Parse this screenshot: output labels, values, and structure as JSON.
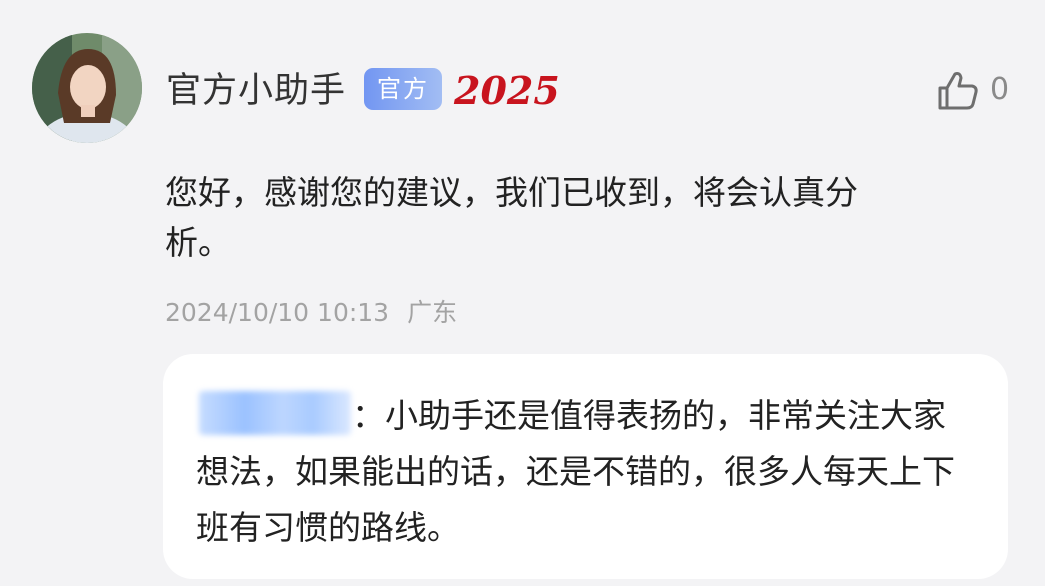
{
  "comment": {
    "avatar_icon": "avatar-photo",
    "username": "官方小助手",
    "badge_label": "官方",
    "year_logo_text": "2025",
    "year_logo_color": "#c8141e",
    "like_icon": "thumbs-up-icon",
    "like_count": "0",
    "text": "您好，感谢您的建议，我们已收到，将会认真分析。",
    "timestamp": "2024/10/10 10:13",
    "location": "广东"
  },
  "reply": {
    "author_blurred": true,
    "text": "：小助手还是值得表扬的，非常关注大家想法，如果能出的话，还是不错的，很多人每天上下班有习惯的路线。"
  }
}
